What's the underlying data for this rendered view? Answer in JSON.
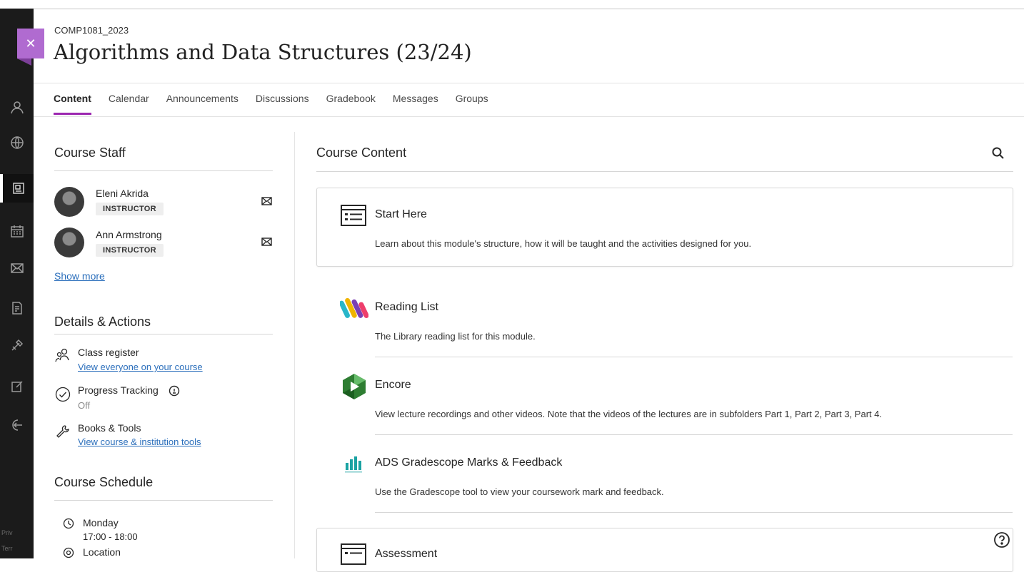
{
  "course": {
    "id": "COMP1081_2023",
    "title": "Algorithms and Data Structures (23/24)"
  },
  "tabs": [
    "Content",
    "Calendar",
    "Announcements",
    "Discussions",
    "Gradebook",
    "Messages",
    "Groups"
  ],
  "active_tab": "Content",
  "sidebar_footer": {
    "line1": "Priv",
    "line2": "Terr"
  },
  "staff": {
    "heading": "Course Staff",
    "members": [
      {
        "name": "Eleni Akrida",
        "role": "INSTRUCTOR"
      },
      {
        "name": "Ann Armstrong",
        "role": "INSTRUCTOR"
      }
    ],
    "show_more": "Show more"
  },
  "details": {
    "heading": "Details & Actions",
    "items": [
      {
        "title": "Class register",
        "link": "View everyone on your course",
        "icon": "people-icon"
      },
      {
        "title": "Progress Tracking",
        "status": "Off",
        "icon": "check-circle-icon"
      },
      {
        "title": "Books & Tools",
        "link": "View course & institution tools",
        "icon": "wrench-icon"
      }
    ]
  },
  "schedule": {
    "heading": "Course Schedule",
    "day": "Monday",
    "time": "17:00 - 18:00",
    "location": "Location"
  },
  "content": {
    "heading": "Course Content",
    "items": [
      {
        "title": "Start Here",
        "description": "Learn about this module's structure, how it will be taught and the activities designed for you.",
        "icon": "document-list-icon"
      },
      {
        "title": "Reading List",
        "description": "The Library reading list for this module.",
        "icon": "reading-list-logo-icon"
      },
      {
        "title": "Encore",
        "description": "View lecture recordings and other videos. Note that the videos of the lectures are in subfolders Part 1, Part 2, Part 3, Part 4.",
        "icon": "encore-logo-icon"
      },
      {
        "title": "ADS Gradescope Marks & Feedback",
        "description": "Use the Gradescope tool to view your coursework mark and feedback.",
        "icon": "gradescope-logo-icon"
      },
      {
        "title": "Assessment",
        "description": "",
        "icon": "document-list-icon"
      }
    ]
  },
  "colors": {
    "accent": "#9c27b0",
    "link": "#2a6ebb",
    "rail": "#1b1b1b"
  }
}
